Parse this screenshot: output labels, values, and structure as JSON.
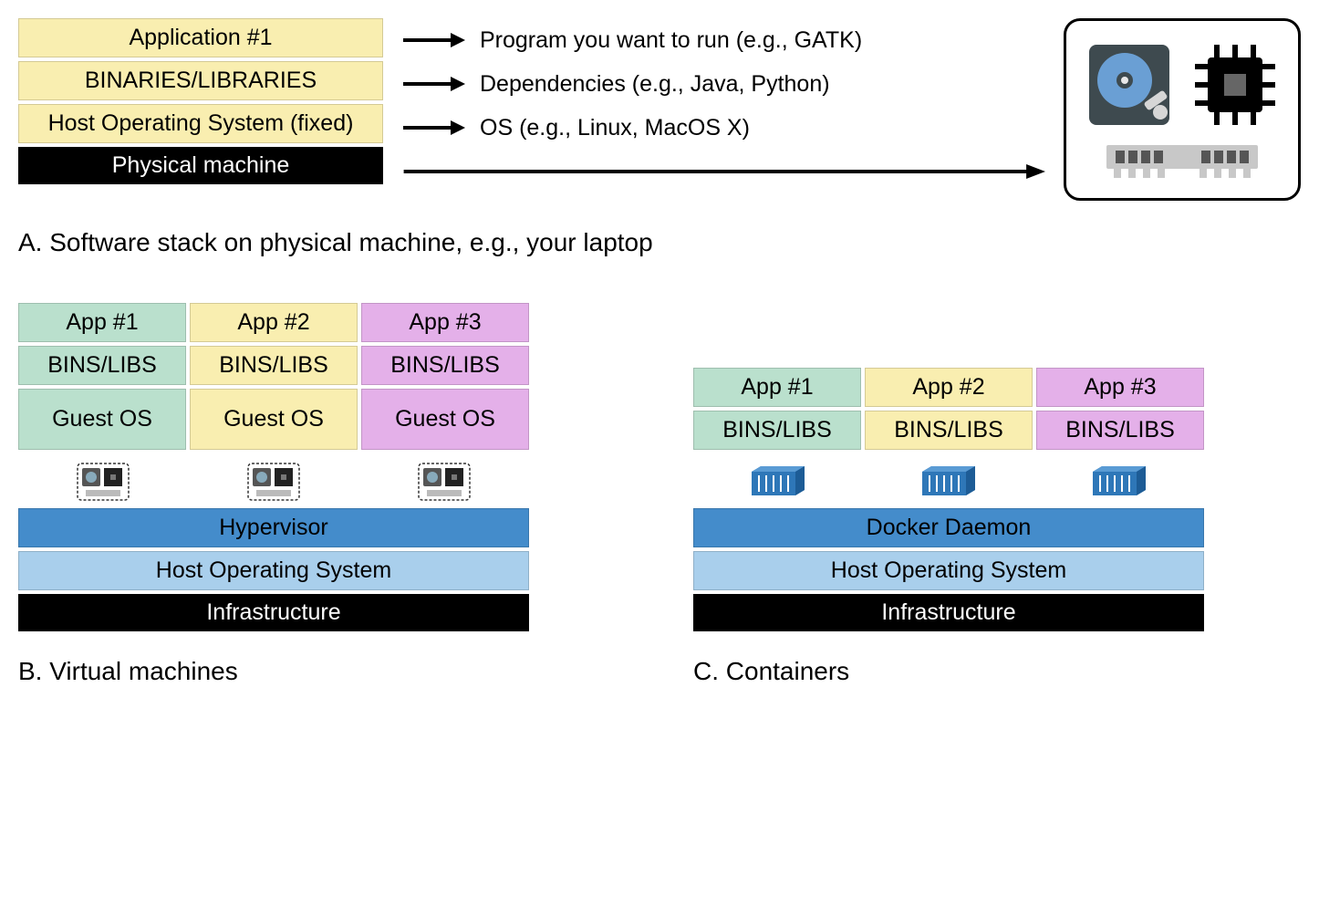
{
  "sectionA": {
    "layers": [
      {
        "label": "Application #1",
        "class": "layer-yellow"
      },
      {
        "label": "BINARIES/LIBRARIES",
        "class": "layer-yellow"
      },
      {
        "label": "Host Operating System (fixed)",
        "class": "layer-yellow"
      },
      {
        "label": "Physical machine",
        "class": "layer-black"
      }
    ],
    "explanations": [
      "Program you want to run (e.g., GATK)",
      "Dependencies (e.g., Java, Python)",
      "OS (e.g., Linux, MacOS X)"
    ],
    "caption": "A. Software stack on physical machine, e.g., your laptop"
  },
  "sectionB": {
    "apps": [
      "App #1",
      "App #2",
      "App #3"
    ],
    "bins": [
      "BINS/LIBS",
      "BINS/LIBS",
      "BINS/LIBS"
    ],
    "guest": [
      "Guest OS",
      "Guest OS",
      "Guest OS"
    ],
    "classes": [
      "layer-green",
      "layer-yellow",
      "layer-pink"
    ],
    "hypervisor": "Hypervisor",
    "hostOS": "Host Operating System",
    "infra": "Infrastructure",
    "caption": "B. Virtual machines"
  },
  "sectionC": {
    "apps": [
      "App #1",
      "App #2",
      "App #3"
    ],
    "bins": [
      "BINS/LIBS",
      "BINS/LIBS",
      "BINS/LIBS"
    ],
    "classes": [
      "layer-green",
      "layer-yellow",
      "layer-pink"
    ],
    "docker": "Docker Daemon",
    "hostOS": "Host Operating System",
    "infra": "Infrastructure",
    "caption": "C. Containers"
  }
}
